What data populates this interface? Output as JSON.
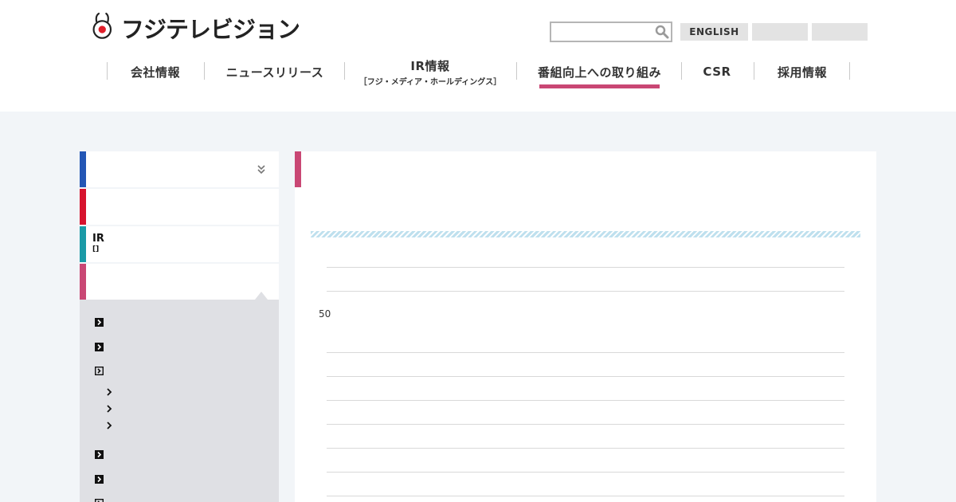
{
  "header": {
    "logo_text": "フジテレビジョン",
    "search": {
      "placeholder": "",
      "value": ""
    },
    "lang_buttons": [
      "ENGLISH",
      "",
      ""
    ],
    "nav": [
      {
        "label": "会社情報",
        "sub": ""
      },
      {
        "label": "ニュースリリース",
        "sub": ""
      },
      {
        "label": "IR情報",
        "sub": "［フジ・メディア・ホールディングス］"
      },
      {
        "label": "番組向上への取り組み",
        "sub": "",
        "active": true
      },
      {
        "label": "CSR",
        "sub": ""
      },
      {
        "label": "採用情報",
        "sub": ""
      }
    ]
  },
  "sidebar": {
    "items": [
      {
        "label": "",
        "color": "#2356b5"
      },
      {
        "label": "",
        "color": "#d7132e"
      },
      {
        "label": "IR",
        "sub": "[]",
        "color": "#1a9aa6"
      },
      {
        "label": "",
        "color": "#c94774"
      }
    ],
    "sub_links": [
      "",
      "",
      "",
      "",
      "",
      ""
    ],
    "sub_sub_links": [
      "",
      "",
      ""
    ]
  },
  "main": {
    "accent_color": "#c94774",
    "axis_tick": "50"
  },
  "colors": {
    "brand_pink": "#c94774",
    "stripe": "#bfe0ee",
    "panel_gray": "#dfe0e4",
    "page_bg": "#f2f5f8"
  }
}
